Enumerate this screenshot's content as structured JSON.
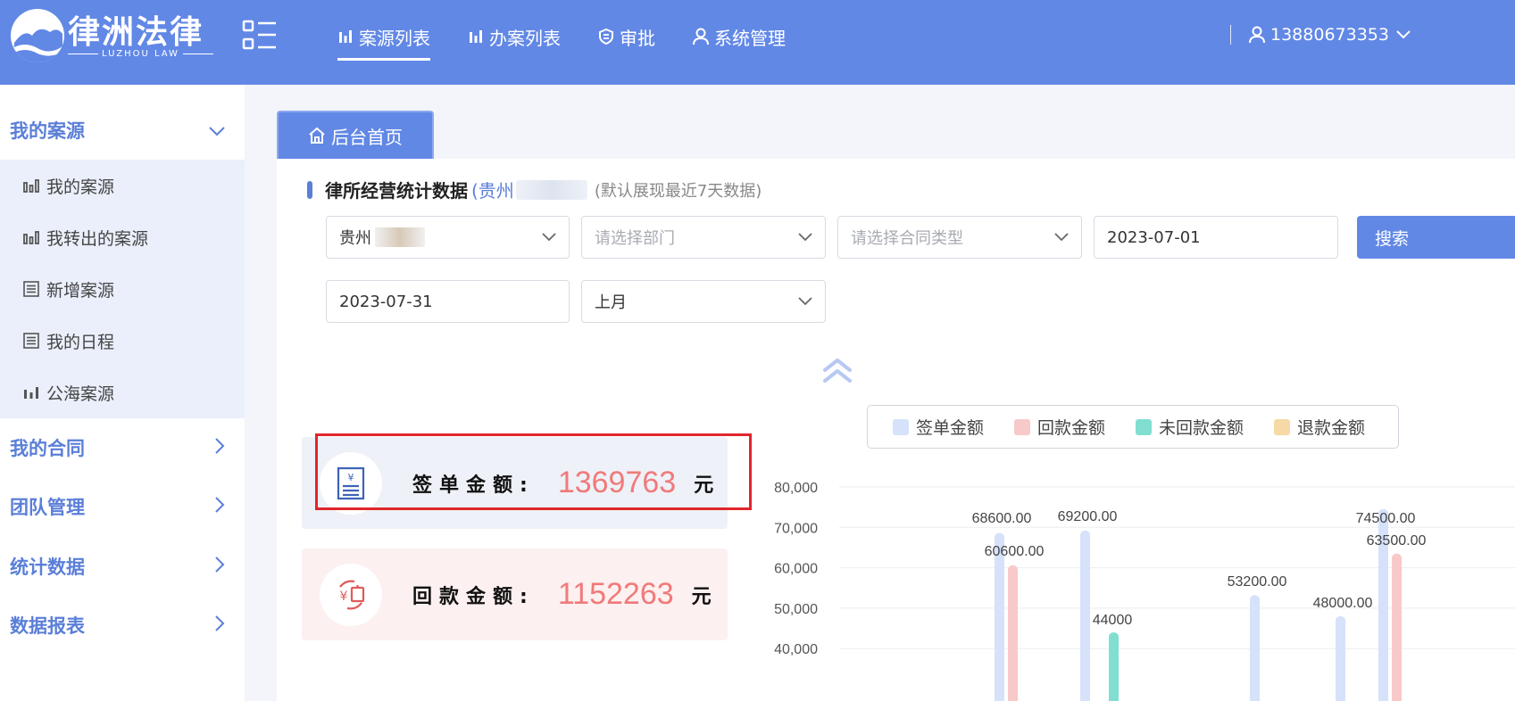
{
  "header": {
    "logo_cn": "律洲法律",
    "logo_en": "LUZHOU LAW",
    "nav": [
      {
        "label": "案源列表",
        "icon": "bar-chart-icon",
        "active": true
      },
      {
        "label": "办案列表",
        "icon": "bar-chart-icon",
        "active": false
      },
      {
        "label": "审批",
        "icon": "shield-icon",
        "active": false
      },
      {
        "label": "系统管理",
        "icon": "user-icon",
        "active": false
      }
    ],
    "user": "13880673353"
  },
  "sidebar": {
    "groups": [
      {
        "label": "我的案源",
        "expanded": true
      },
      {
        "label": "我的合同",
        "expanded": false
      },
      {
        "label": "团队管理",
        "expanded": false
      },
      {
        "label": "统计数据",
        "expanded": false
      },
      {
        "label": "数据报表",
        "expanded": false
      }
    ],
    "sub_items": [
      {
        "label": "我的案源",
        "icon": "bar-chart-icon"
      },
      {
        "label": "我转出的案源",
        "icon": "bar-chart-icon"
      },
      {
        "label": "新增案源",
        "icon": "list-icon"
      },
      {
        "label": "我的日程",
        "icon": "list-icon"
      },
      {
        "label": "公海案源",
        "icon": "bar-chart-icon"
      }
    ]
  },
  "tab": {
    "label": "后台首页"
  },
  "section": {
    "title": "律所经营统计数据",
    "org_prefix": "(贵州",
    "note": "(默认展现最近7天数据)"
  },
  "filters": {
    "region_value": "贵州",
    "department_placeholder": "请选择部门",
    "contract_type_placeholder": "请选择合同类型",
    "start_date": "2023-07-01",
    "end_date": "2023-07-31",
    "period": "上月",
    "search_label": "搜索"
  },
  "stats": [
    {
      "label": "签单金额:",
      "value": "1369763",
      "unit": "元",
      "bg": "#eef1f7",
      "icon": "receipt-icon"
    },
    {
      "label": "回款金额:",
      "value": "1152263",
      "unit": "元",
      "bg": "#fdf0f0",
      "icon": "refund-icon"
    }
  ],
  "legend": [
    {
      "label": "签单金额",
      "color": "#d5e2fa"
    },
    {
      "label": "回款金额",
      "color": "#f8c9c9"
    },
    {
      "label": "未回款金额",
      "color": "#80dfd1"
    },
    {
      "label": "退款金额",
      "color": "#f6d9a4"
    }
  ],
  "chart_data": {
    "type": "bar",
    "ylim": [
      40000,
      80000
    ],
    "y_ticks": [
      "80,000",
      "70,000",
      "60,000",
      "50,000",
      "40,000"
    ],
    "y_tick_values": [
      80000,
      70000,
      60000,
      50000,
      40000
    ],
    "series": [
      {
        "name": "签单金额",
        "color": "#d5e2fa",
        "values": [
          68600,
          69200,
          53200,
          48000,
          74500
        ]
      },
      {
        "name": "回款金额",
        "color": "#f8c9c9",
        "values": [
          60600,
          null,
          null,
          null,
          63500
        ]
      },
      {
        "name": "未回款金额",
        "color": "#80dfd1",
        "values": [
          null,
          44000,
          null,
          null,
          null
        ]
      }
    ],
    "data_labels": [
      {
        "text": "68600.00"
      },
      {
        "text": "60600.00"
      },
      {
        "text": "69200.00"
      },
      {
        "text": "44000"
      },
      {
        "text": "53200.00"
      },
      {
        "text": "48000.00"
      },
      {
        "text": "74500.00"
      },
      {
        "text": "63500.00"
      }
    ]
  }
}
